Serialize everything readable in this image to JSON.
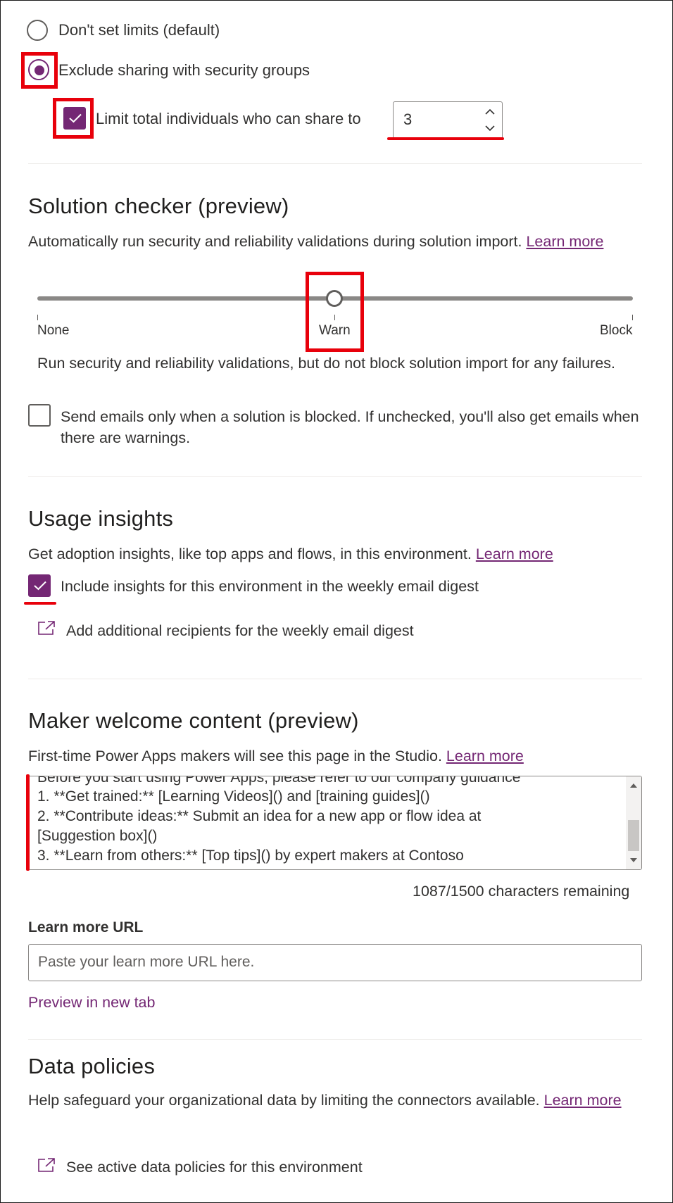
{
  "sharing": {
    "option_no_limits": "Don't set limits (default)",
    "option_exclude": "Exclude sharing with security groups",
    "limit_label": "Limit total individuals who can share to",
    "limit_value": "3"
  },
  "solution_checker": {
    "title": "Solution checker (preview)",
    "description": "Automatically run security and reliability validations during solution import.",
    "learn_more": "Learn more",
    "levels": [
      "None",
      "Warn",
      "Block"
    ],
    "selected_level": "Warn",
    "level_description": "Run security and reliability validations, but do not block solution import for any failures.",
    "email_option": "Send emails only when a solution is blocked. If unchecked, you'll also get emails when there are warnings.",
    "email_option_checked": false
  },
  "usage_insights": {
    "title": "Usage insights",
    "description": "Get adoption insights, like top apps and flows, in this environment.",
    "learn_more": "Learn more",
    "include_label": "Include insights for this environment in the weekly email digest",
    "include_checked": true,
    "add_recipients": "Add additional recipients for the weekly email digest",
    "add_recipients_icon": "open-in-new-window-icon"
  },
  "maker_welcome": {
    "title": "Maker welcome content (preview)",
    "description": "First-time Power Apps makers will see this page in the Studio.",
    "learn_more": "Learn more",
    "content_lines": [
      "Before you start using Power Apps, please refer to our company guidance",
      "1. **Get trained:** [Learning Videos]() and [training guides]()",
      "2. **Contribute ideas:** Submit an idea for a new app or flow idea at",
      "[Suggestion box]()",
      "3. **Learn from others:** [Top tips]() by expert makers at Contoso"
    ],
    "chars_remaining": "1087/1500 characters remaining",
    "url_label": "Learn more URL",
    "url_placeholder": "Paste your learn more URL here.",
    "preview_link": "Preview in new tab"
  },
  "data_policies": {
    "title": "Data policies",
    "description": "Help safeguard your organizational data by limiting the connectors available.",
    "learn_more": "Learn more",
    "see_active": "See active data policies for this environment",
    "see_active_icon": "open-in-new-window-icon"
  },
  "colors": {
    "accent": "#742774",
    "highlight": "#e8000b",
    "text": "#323130"
  }
}
